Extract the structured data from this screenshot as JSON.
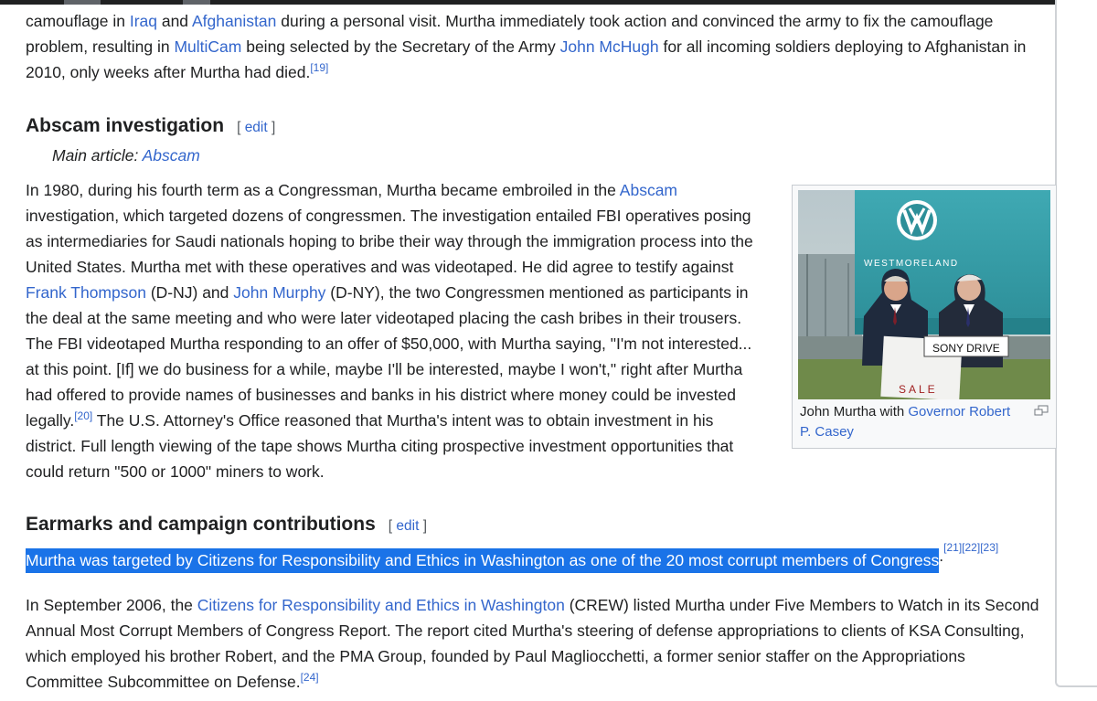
{
  "para_top": {
    "lines": [
      [
        "camouflage in ",
        {
          "link": "Iraq"
        },
        " and ",
        {
          "link": "Afghanistan"
        },
        " during a personal visit. Murtha immediately took action and convinced the army to fix the camouflage"
      ],
      [
        "problem, resulting in ",
        {
          "link": "MultiCam"
        },
        " being selected by the Secretary of the Army ",
        {
          "link": "John McHugh"
        },
        " for all incoming soldiers deploying to Afghanistan in"
      ],
      [
        "2010, only weeks after Murtha had died.",
        {
          "ref": "[19]"
        }
      ]
    ]
  },
  "section_abscam": {
    "title": "Abscam investigation",
    "edit_open": "[",
    "edit_label": "edit",
    "edit_close": "]"
  },
  "hatnote": {
    "prefix": "Main article: ",
    "link": "Abscam"
  },
  "para_abscam": {
    "lines": [
      [
        "In 1980, during his fourth term as a Congressman, Murtha became embroiled in the ",
        {
          "link": "Abscam"
        }
      ],
      [
        "investigation, which targeted dozens of congressmen. The investigation entailed FBI operatives posing"
      ],
      [
        "as intermediaries for Saudi nationals hoping to bribe their way through the immigration process into the"
      ],
      [
        "United States. Murtha met with these operatives and was videotaped. He did agree to testify against"
      ],
      [
        {
          "link": "Frank Thompson"
        },
        " (D-NJ) and ",
        {
          "link": "John Murphy"
        },
        " (D-NY), the two Congressmen mentioned as participants in"
      ],
      [
        "the deal at the same meeting and who were later videotaped placing the cash bribes in their trousers."
      ],
      [
        "The FBI videotaped Murtha responding to an offer of $50,000, with Murtha saying, \"I'm not interested..."
      ],
      [
        "at this point. [If] we do business for a while, maybe I'll be interested, maybe I won't,\" right after Murtha"
      ],
      [
        "had offered to provide names of businesses and banks in his district where money could be invested"
      ],
      [
        "legally.",
        {
          "ref": "[20]"
        },
        " The U.S. Attorney's Office reasoned that Murtha's intent was to obtain investment in his"
      ],
      [
        "district. Full length viewing of the tape shows Murtha citing prospective investment opportunities that"
      ],
      [
        "could return \"500 or 1000\" miners to work."
      ]
    ]
  },
  "figure": {
    "photo_sign_building": "WESTMORELAND",
    "photo_sign_held": "SONY DRIVE",
    "photo_sign_sale": "SALE",
    "caption_prefix": "John Murtha with ",
    "caption_link_1": "Governor Robert",
    "caption_link_2": "P. Casey",
    "enlarge_icon": "enlarge-icon"
  },
  "section_earmarks": {
    "title": "Earmarks and campaign contributions",
    "edit_open": "[",
    "edit_label": "edit",
    "edit_close": "]"
  },
  "para_crew_highlight": {
    "text": "Murtha was targeted by Citizens for Responsibility and Ethics in Washington as one of the 20 most corrupt members of Congress",
    "period": ".",
    "refs": [
      "[21]",
      "[22]",
      "[23]"
    ]
  },
  "para_2006": {
    "lines": [
      [
        "In September 2006, the ",
        {
          "link": "Citizens for Responsibility and Ethics in Washington"
        },
        " (CREW) listed Murtha under Five Members to Watch in its Second"
      ],
      [
        "Annual Most Corrupt Members of Congress Report. The report cited Murtha's steering of defense appropriations to clients of KSA Consulting,"
      ],
      [
        "which employed his brother Robert, and the PMA Group, founded by Paul Magliocchetti, a former senior staffer on the Appropriations"
      ],
      [
        "Committee Subcommittee on Defense.",
        {
          "ref": "[24]"
        }
      ]
    ]
  },
  "colors": {
    "link": "#3366cc",
    "text": "#202122",
    "selection": "#1a73e8"
  }
}
